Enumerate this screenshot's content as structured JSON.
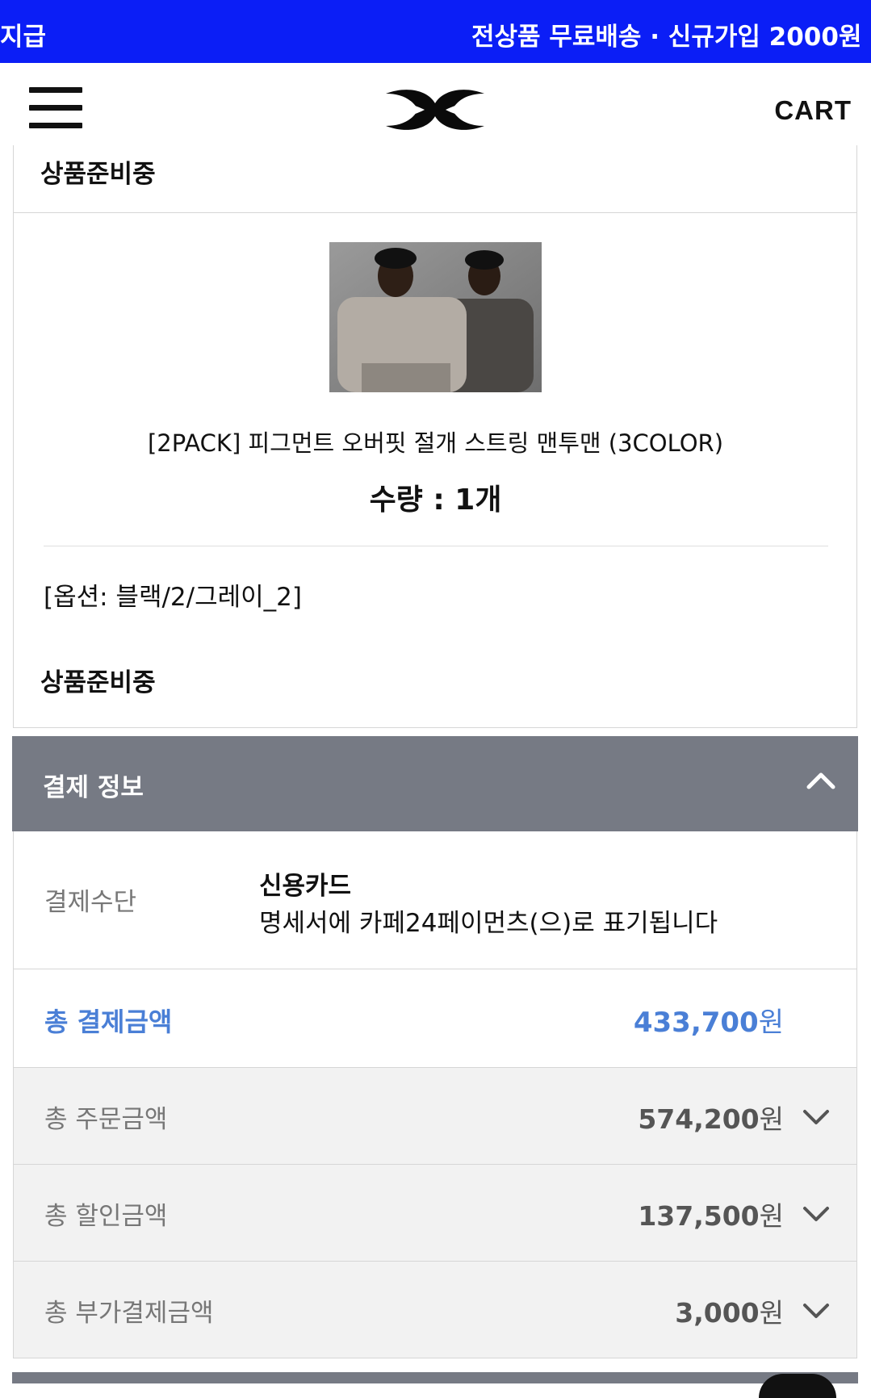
{
  "banner": {
    "left_text": "지급",
    "right_text": "전상품 무료배송  ·  신규가입 2000원",
    "bg_color": "#0b1ef6"
  },
  "header": {
    "menu_icon": "hamburger-menu-icon",
    "logo_icon": "brand-logo-icon",
    "cart_label": "CART"
  },
  "order_item": {
    "status_top": "상품준비중",
    "product_name": "[2PACK] 피그먼트 오버핏 절개 스트링 맨투맨 (3COLOR)",
    "quantity": "수량 : 1개",
    "option": "[옵션: 블랙/2/그레이_2]",
    "status_bottom": "상품준비중"
  },
  "payment": {
    "section_title": "결제 정보",
    "method_label": "결제수단",
    "method_value": "신용카드",
    "method_note": "명세서에 카페24페이먼츠(으)로 표기됩니다",
    "total_label": "총 결제금액",
    "total_amount": "433,700",
    "currency": "원",
    "accent_color": "#4a7fd6",
    "rows": [
      {
        "label": "총 주문금액",
        "amount": "574,200",
        "currency": "원"
      },
      {
        "label": "총 할인금액",
        "amount": "137,500",
        "currency": "원"
      },
      {
        "label": "총 부가결제금액",
        "amount": "3,000",
        "currency": "원"
      }
    ]
  }
}
